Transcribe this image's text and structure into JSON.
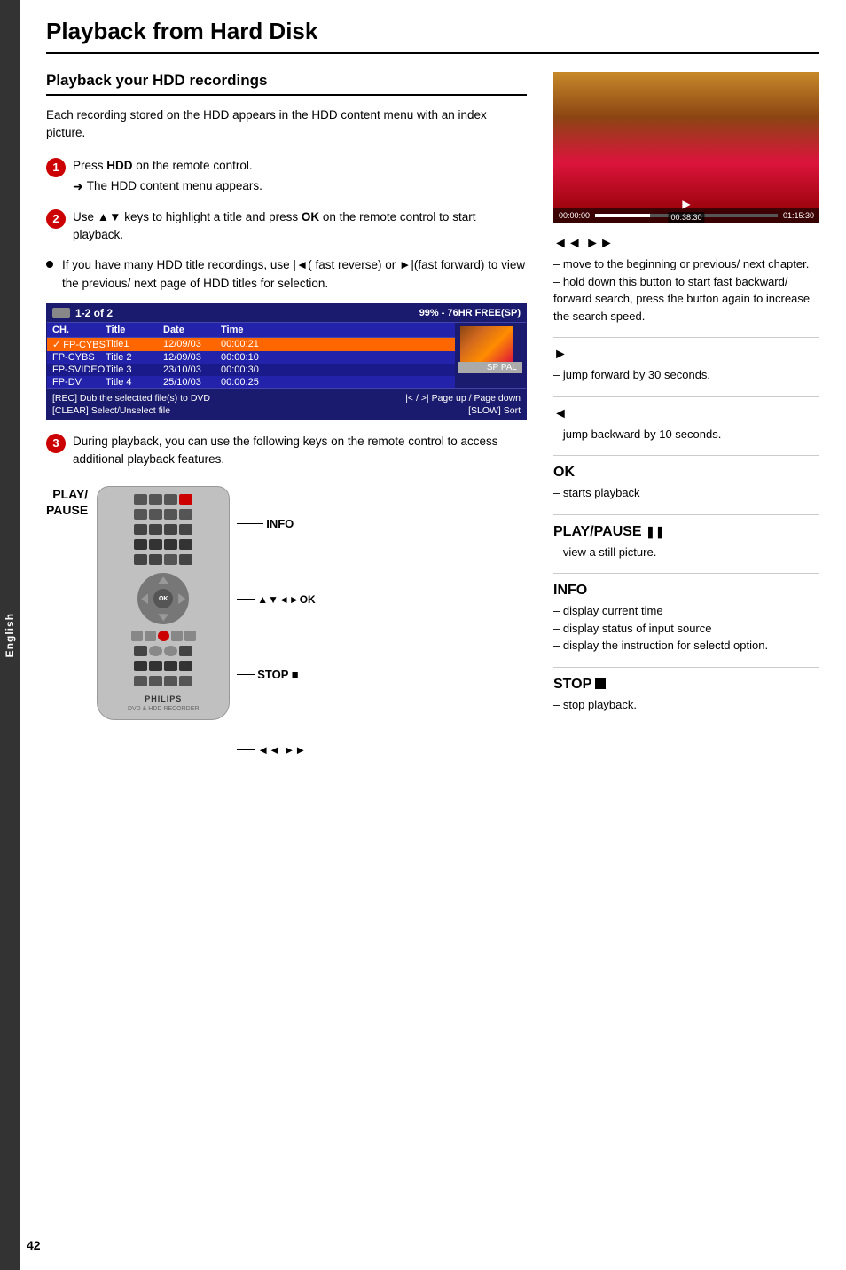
{
  "sidebar": {
    "label": "English"
  },
  "page": {
    "title": "Playback from Hard Disk",
    "number": "42"
  },
  "left_col": {
    "section_title": "Playback your HDD recordings",
    "intro": "Each recording stored on the HDD appears in the HDD content menu with an index picture.",
    "steps": [
      {
        "number": "1",
        "text_parts": [
          "Press ",
          "HDD",
          " on the remote control."
        ],
        "arrow_text": "The HDD content menu appears."
      },
      {
        "number": "2",
        "text_html": "Use ▲▼ keys to highlight a title and press OK on the remote control to start playback."
      },
      {
        "number": "3",
        "text": "During playback, you can use the following keys on the remote control to access additional playback features."
      }
    ],
    "bullet": {
      "text": "If you have many HDD title recordings, use |◄( fast reverse) or ►|(fast forward) to view the previous/ next page of HDD titles for selection."
    }
  },
  "hdd_table": {
    "header": {
      "icon": "HDD",
      "pages": "1-2 of 2",
      "free": "99% - 76HR  FREE(SP)"
    },
    "columns": [
      "CH.",
      "Title",
      "Date",
      "Time"
    ],
    "rows": [
      {
        "ch": "FP-CYBS",
        "title": "Title1",
        "date": "12/09/03",
        "time": "00:00:21",
        "selected": true
      },
      {
        "ch": "FP-CYBS",
        "title": "Title 2",
        "date": "12/09/03",
        "time": "00:00:10",
        "selected": false
      },
      {
        "ch": "FP-SVIDEO",
        "title": "Title 3",
        "date": "23/10/03",
        "time": "00:00:30",
        "selected": false
      },
      {
        "ch": "FP-DV",
        "title": "Title 4",
        "date": "25/10/03",
        "time": "00:00:25",
        "selected": false
      }
    ],
    "sp_pal": "SP PAL",
    "footer_row1_left": "[REC]  Dub the selectted file(s) to DVD",
    "footer_row1_right": "|<  /  >|  Page up / Page down",
    "footer_row2_left": "[CLEAR]  Select/Unselect file",
    "footer_row2_right": "[SLOW]  Sort"
  },
  "right_col": {
    "video": {
      "time_left": "00:00:00",
      "time_right": "01:15:30",
      "time_center": "00:38:30"
    },
    "keys": [
      {
        "id": "rewind_fwd",
        "symbol": "◄◄  ►►",
        "descs": [
          "– move to the beginning or previous/ next chapter.",
          "– hold down this button to start fast backward/ forward search, press the button again to increase the search speed."
        ]
      },
      {
        "id": "forward30",
        "symbol": "►",
        "descs": [
          "– jump forward by 30 seconds."
        ]
      },
      {
        "id": "backward10",
        "symbol": "◄",
        "descs": [
          "– jump backward by 10 seconds."
        ]
      },
      {
        "id": "ok",
        "symbol": "OK",
        "descs": [
          "– starts playback"
        ]
      },
      {
        "id": "play_pause",
        "symbol": "PLAY/PAUSE ❚❚",
        "descs": [
          "– view a still picture."
        ]
      },
      {
        "id": "info",
        "symbol": "INFO",
        "descs": [
          "– display current time",
          "– display status of input source",
          "– display the instruction for selectd option."
        ]
      },
      {
        "id": "stop",
        "symbol": "STOP ■",
        "descs": [
          "– stop playback."
        ]
      }
    ]
  },
  "remote": {
    "play_pause_label": "PLAY/\nPAUSE",
    "info_label": "INFO",
    "nav_label": "▲▼◄►OK",
    "stop_label": "STOP ■",
    "rewind_fwd_label": "◄◄  ►►",
    "brand": "PHILIPS"
  }
}
